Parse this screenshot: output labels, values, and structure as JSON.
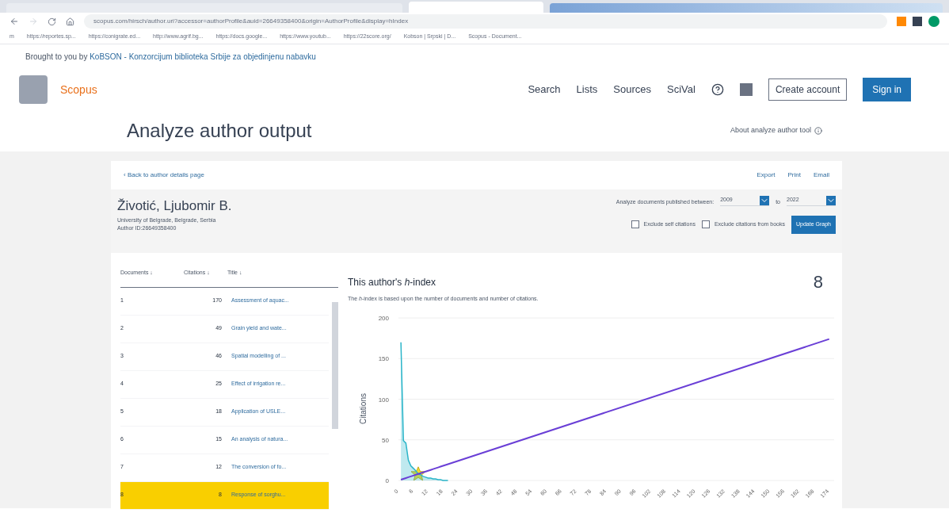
{
  "browser": {
    "url": "scopus.com/hirsch/author.uri?accessor=authorProfile&auid=26649358400&origin=AuthorProfile&display=hIndex",
    "bookmarks": [
      "m",
      "https://reportes.sp...",
      "https://conigrate.ed...",
      "http://www.agrif.bg...",
      "https://docs.google...",
      "https://www.youtub...",
      "https://22score.org/",
      "Kobson | Srpski | D...",
      "Scopus - Document..."
    ]
  },
  "brought_by": {
    "prefix": "Brought to you by",
    "link": "KoBSON - Konzorcijum biblioteka Srbije za objedinjenu nabavku"
  },
  "header": {
    "logo": "Scopus",
    "nav": [
      "Search",
      "Lists",
      "Sources",
      "SciVal"
    ],
    "create_account": "Create account",
    "sign_in": "Sign in"
  },
  "page_title": "Analyze author output",
  "about_link": "About analyze author tool",
  "toolbar": {
    "back": "‹ Back to author details page",
    "actions": [
      "Export",
      "Print",
      "Email"
    ]
  },
  "author": {
    "name": "Životić, Ljubomir B.",
    "affiliation": "University of Belgrade, Belgrade, Serbia",
    "author_id": "Author ID:26649358400"
  },
  "filters": {
    "label": "Analyze documents published between:",
    "from": "2009",
    "to_label": "to",
    "to": "2022",
    "exclude_self": {
      "label": "Exclude self citations",
      "checked": false
    },
    "exclude_books": {
      "label": "Exclude citations from books",
      "checked": false
    },
    "button": "Update Graph"
  },
  "table": {
    "columns": [
      "Documents ↓",
      "Citations ↓",
      "Title ↓"
    ],
    "rows": [
      {
        "documents": "1",
        "citations": "170",
        "title": "Assessment of aquac...",
        "selected": false
      },
      {
        "documents": "2",
        "citations": "49",
        "title": "Grain yield and wate...",
        "selected": false
      },
      {
        "documents": "3",
        "citations": "46",
        "title": "Spatial modelling of ...",
        "selected": false
      },
      {
        "documents": "4",
        "citations": "25",
        "title": "Effect of irrigation re...",
        "selected": false
      },
      {
        "documents": "5",
        "citations": "18",
        "title": "Application of USLE...",
        "selected": false
      },
      {
        "documents": "6",
        "citations": "15",
        "title": "An analysis of natura...",
        "selected": false
      },
      {
        "documents": "7",
        "citations": "12",
        "title": "The conversion of fo...",
        "selected": false
      },
      {
        "documents": "8",
        "citations": "8",
        "title": "Response of sorghu...",
        "selected": true
      }
    ]
  },
  "hindex": {
    "title_prefix": "This author's ",
    "title_italic": "h",
    "title_suffix": "-index",
    "value": "8",
    "description": "The *h*-index is based upon the number of documents and number of citations.",
    "chart_data": {
      "type": "line",
      "ylabel": "Citations",
      "x": [
        1,
        2,
        3,
        4,
        5,
        6,
        7,
        8,
        9,
        10,
        11,
        12,
        13,
        14,
        15,
        16,
        17,
        18,
        19,
        20,
        174
      ],
      "series": [
        {
          "color": "#2bb5c9",
          "values": [
            170,
            49,
            46,
            25,
            18,
            15,
            12,
            8,
            7,
            5,
            4,
            3,
            3,
            2,
            2,
            1,
            1,
            0,
            0,
            0,
            null
          ]
        },
        {
          "color": "#6a3fd6",
          "values": [
            1,
            2,
            3,
            4,
            5,
            6,
            7,
            8,
            9,
            10,
            11,
            12,
            13,
            14,
            15,
            16,
            17,
            18,
            19,
            20,
            174
          ]
        }
      ],
      "grid": true,
      "ylim": [
        0,
        200
      ],
      "yticks": [
        0,
        50,
        100,
        150,
        200
      ],
      "xlim": [
        0,
        176
      ],
      "xticks": [
        0,
        6,
        12,
        18,
        24,
        30,
        36,
        42,
        48,
        54,
        60,
        66,
        72,
        78,
        84,
        90,
        96,
        102,
        108,
        114,
        120,
        126,
        132,
        138,
        144,
        150,
        156,
        162,
        168,
        174
      ]
    }
  }
}
